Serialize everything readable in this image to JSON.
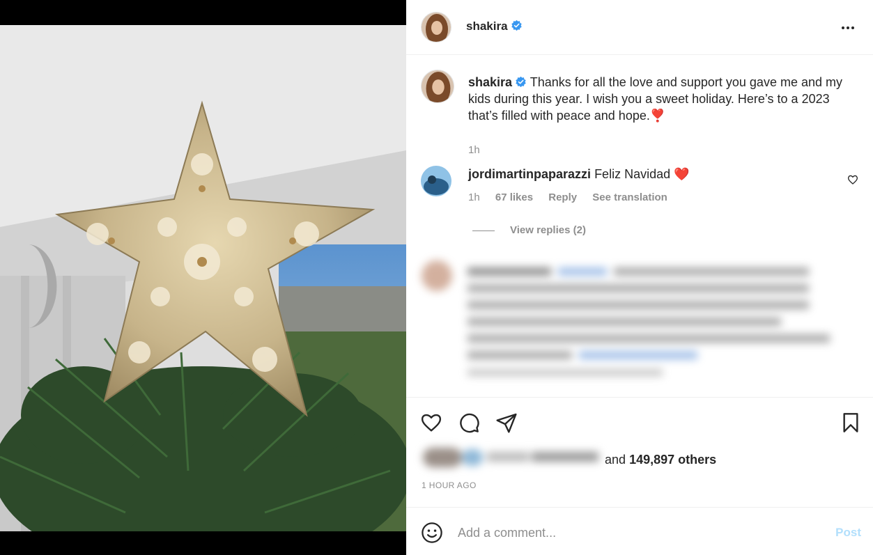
{
  "post": {
    "author": "shakira",
    "verified": true,
    "caption": "Thanks for all the love and support you gave me and my kids during this year. I wish you a sweet holiday. Here’s to a 2023 that’s filled with peace and hope.❣️",
    "caption_time": "1h"
  },
  "comments": [
    {
      "user": "jordimartinpaparazzi",
      "text": "Feliz Navidad",
      "emoji": "❤️",
      "time": "1h",
      "likes": "67 likes",
      "reply_label": "Reply",
      "translation_label": "See translation",
      "view_replies": "View replies (2)"
    }
  ],
  "likes": {
    "prefix": "and",
    "count": "149,897 others"
  },
  "timestamp": "1 HOUR AGO",
  "comment_box": {
    "placeholder": "Add a comment...",
    "post_label": "Post"
  },
  "icons": {
    "more": "more-options-icon",
    "verified": "verified-badge-icon",
    "like": "heart-icon",
    "comment": "comment-bubble-icon",
    "share": "paper-plane-icon",
    "save": "bookmark-icon",
    "emoji": "smiley-face-icon"
  },
  "colors": {
    "verified": "#3897f0",
    "post_disabled": "#b2dffc",
    "secondary_text": "#8e8e8e",
    "heart_red": "#ed1c24"
  }
}
